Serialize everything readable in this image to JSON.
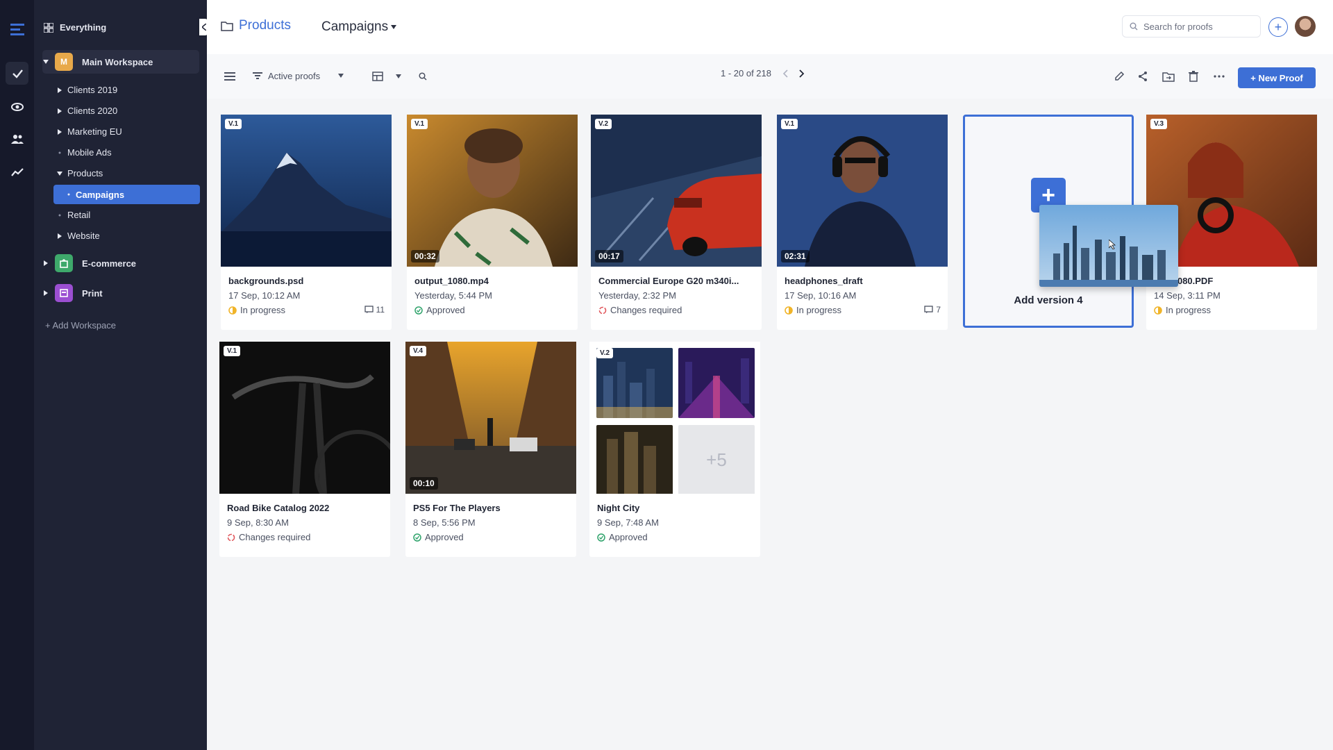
{
  "sidebar": {
    "everything_label": "Everything",
    "main_workspace": {
      "initial": "M",
      "label": "Main Workspace"
    },
    "folders": [
      {
        "label": "Clients 2019"
      },
      {
        "label": "Clients 2020"
      },
      {
        "label": "Marketing EU"
      },
      {
        "label": "Mobile Ads"
      },
      {
        "label": "Products"
      },
      {
        "label": "Campaigns"
      },
      {
        "label": "Retail"
      },
      {
        "label": "Website"
      }
    ],
    "workspaces": [
      {
        "label": "E-commerce"
      },
      {
        "label": "Print"
      }
    ],
    "add_workspace": "+ Add Workspace"
  },
  "header": {
    "breadcrumb_products": "Products",
    "breadcrumb_campaigns": "Campaigns",
    "search_placeholder": "Search for proofs"
  },
  "toolbar": {
    "filter_label": "Active proofs",
    "pagination": "1 - 20 of 218",
    "new_proof": "+ New Proof"
  },
  "cards": [
    {
      "version": "V.1",
      "title": "backgrounds.psd",
      "date": "17 Sep, 10:12 AM",
      "status": "In progress",
      "comments": "11"
    },
    {
      "version": "V.1",
      "duration": "00:32",
      "title": "output_1080.mp4",
      "date": "Yesterday, 5:44 PM",
      "status": "Approved"
    },
    {
      "version": "V.2",
      "duration": "00:17",
      "title": "Commercial Europe G20 m340i...",
      "date": "Yesterday, 2:32 PM",
      "status": "Changes required"
    },
    {
      "version": "V.1",
      "duration": "02:31",
      "title": "headphones_draft",
      "date": "17 Sep, 10:16 AM",
      "status": "In progress",
      "comments": "7"
    },
    {
      "version": "V.3",
      "title": "ut2_1080.PDF",
      "date": "14 Sep, 3:11 PM",
      "status": "In progress"
    },
    {
      "version": "V.1",
      "title": "Road Bike Catalog 2022",
      "date": "9 Sep, 8:30 AM",
      "status": "Changes required"
    },
    {
      "version": "V.4",
      "duration": "00:10",
      "title": "PS5 For The Players",
      "date": "8 Sep, 5:56 PM",
      "status": "Approved"
    },
    {
      "version": "V.2",
      "title": "Night City",
      "date": "9 Sep, 7:48 AM",
      "status": "Approved",
      "more_count": "+5"
    }
  ],
  "drop_target": {
    "label": "Add version 4"
  },
  "colors": {
    "accent": "#3d6fd6",
    "approved": "#2fa36b",
    "in_progress": "#f0b429",
    "changes_required": "#e0565b"
  }
}
